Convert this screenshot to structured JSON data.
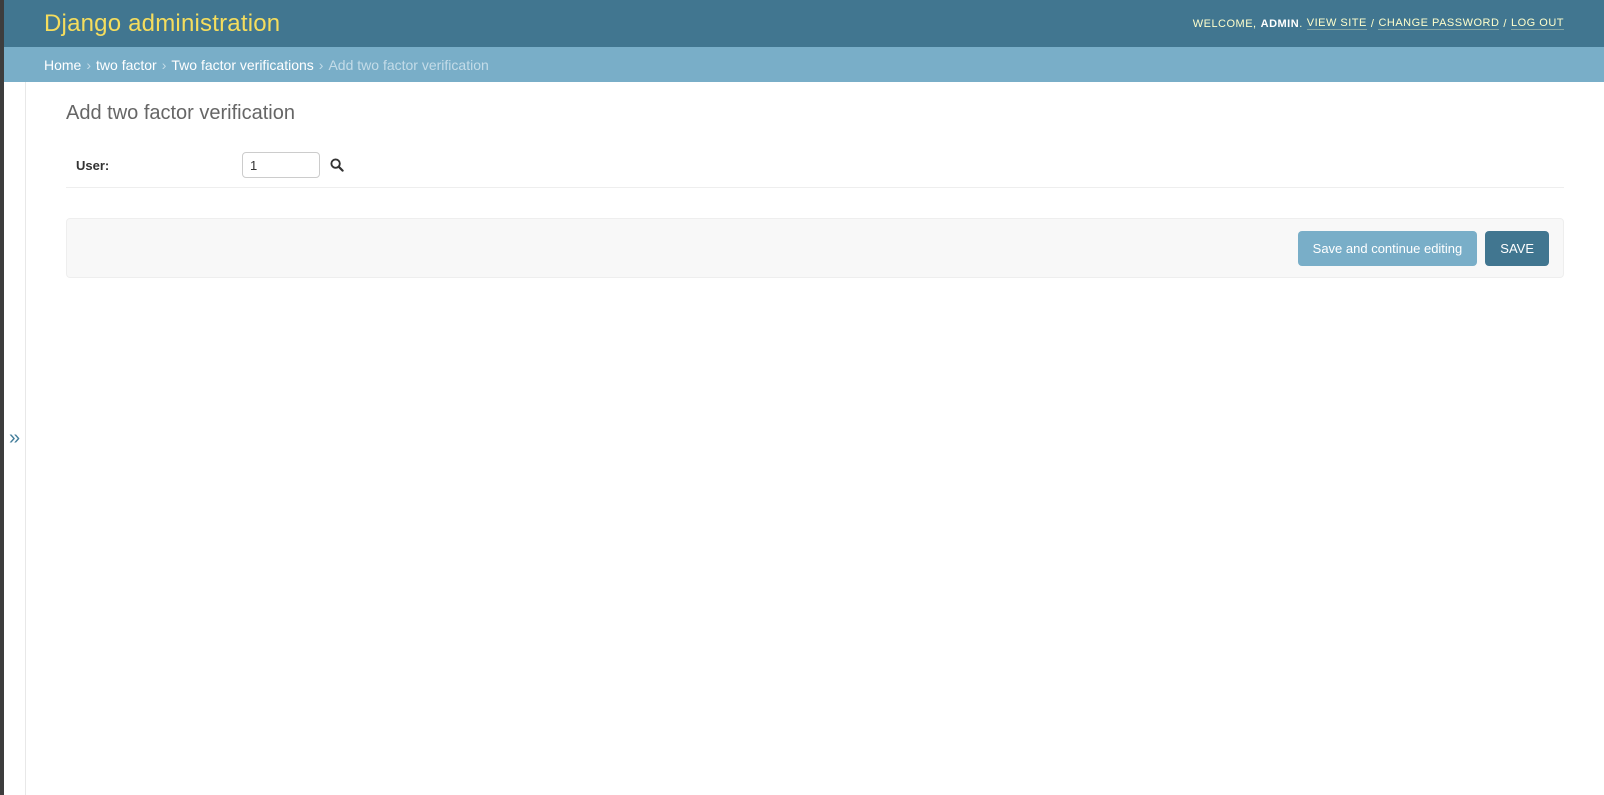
{
  "header": {
    "site_title": "Django administration",
    "welcome": "Welcome,",
    "username": "admin",
    "sep1": ".",
    "view_site": "View site",
    "sep2": "/",
    "change_password": "Change password",
    "sep3": "/",
    "log_out": "Log out"
  },
  "breadcrumbs": {
    "home": "Home",
    "app": "two factor",
    "model": "Two factor verifications",
    "current": "Add two factor verification",
    "separator": "›"
  },
  "sidebar": {
    "toggle_glyph": "»"
  },
  "form": {
    "title": "Add two factor verification",
    "user_label": "User:",
    "user_value": "1",
    "lookup_icon": "search-icon"
  },
  "submit": {
    "continue_label": "Save and continue editing",
    "save_label": "Save"
  },
  "colors": {
    "header_bg": "#417690",
    "breadcrumb_bg": "#79aec8",
    "brand_yellow": "#f5dd5d"
  }
}
